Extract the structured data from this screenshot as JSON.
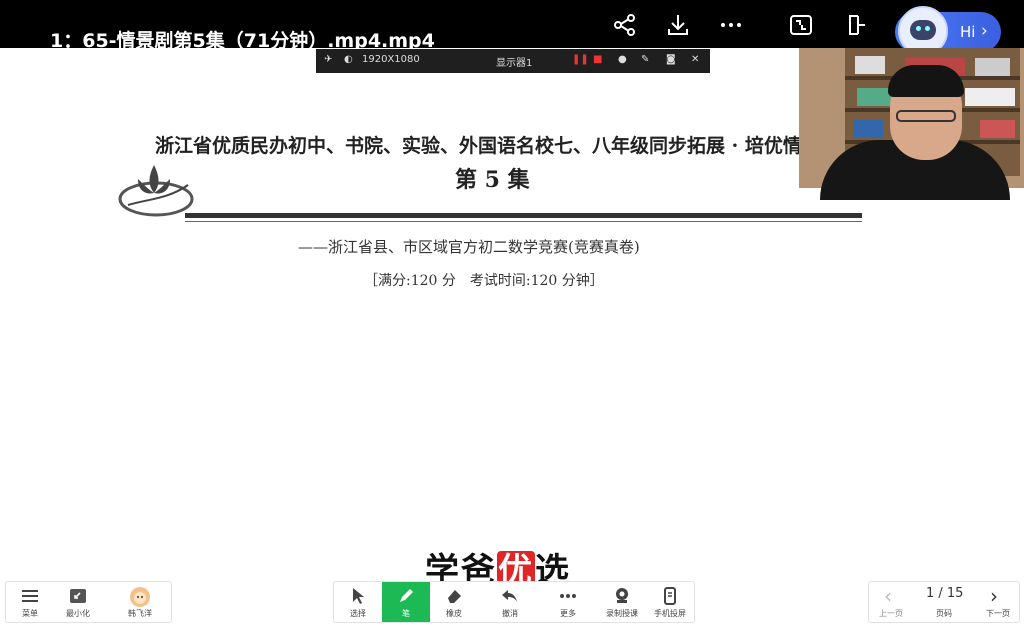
{
  "window": {
    "title": "1：65-情景剧第5集（71分钟）.mp4.mp4"
  },
  "top_actions": [
    {
      "name": "share-icon"
    },
    {
      "name": "download-icon"
    },
    {
      "name": "more-icon"
    },
    {
      "name": "screen-fit-icon"
    },
    {
      "name": "popout-icon"
    }
  ],
  "assistant": {
    "label": "Hi",
    "chevron": "›"
  },
  "screen_toolbar": {
    "resolution": "1920X1080",
    "display": "显示器1"
  },
  "document": {
    "header": "浙江省优质民办初中、书院、实验、外国语名校七、八年级同步拓展 · 培优情景剧首",
    "episode": "第 5 集",
    "subtitle": "——浙江省县、市区域官方初二数学竞赛(竞赛真卷)",
    "meta": "［满分:120 分　考试时间:120 分钟］"
  },
  "watermark": {
    "part1": "学爸",
    "highlight": "优",
    "part2": "选"
  },
  "bottom_left": [
    {
      "label": "菜单",
      "icon": "menu-icon"
    },
    {
      "label": "最小化",
      "icon": "minimize-icon"
    },
    {
      "label": "韩飞洋",
      "icon": "avatar"
    }
  ],
  "bottom_center": [
    {
      "label": "选择",
      "icon": "cursor-icon"
    },
    {
      "label": "笔",
      "icon": "pen-icon"
    },
    {
      "label": "橡皮",
      "icon": "eraser-icon"
    },
    {
      "label": "撤消",
      "icon": "undo-icon"
    },
    {
      "label": "更多",
      "icon": "more-icon"
    },
    {
      "label": "录制授课",
      "icon": "record-icon"
    },
    {
      "label": "手机投屏",
      "icon": "phone-cast-icon"
    }
  ],
  "pager": {
    "current": "1 / 15",
    "prev": "上一页",
    "page": "页码",
    "next": "下一页"
  },
  "colors": {
    "active_tool": "#1db954",
    "watermark_highlight": "#e02626",
    "assistant": "#4b7bf5"
  }
}
